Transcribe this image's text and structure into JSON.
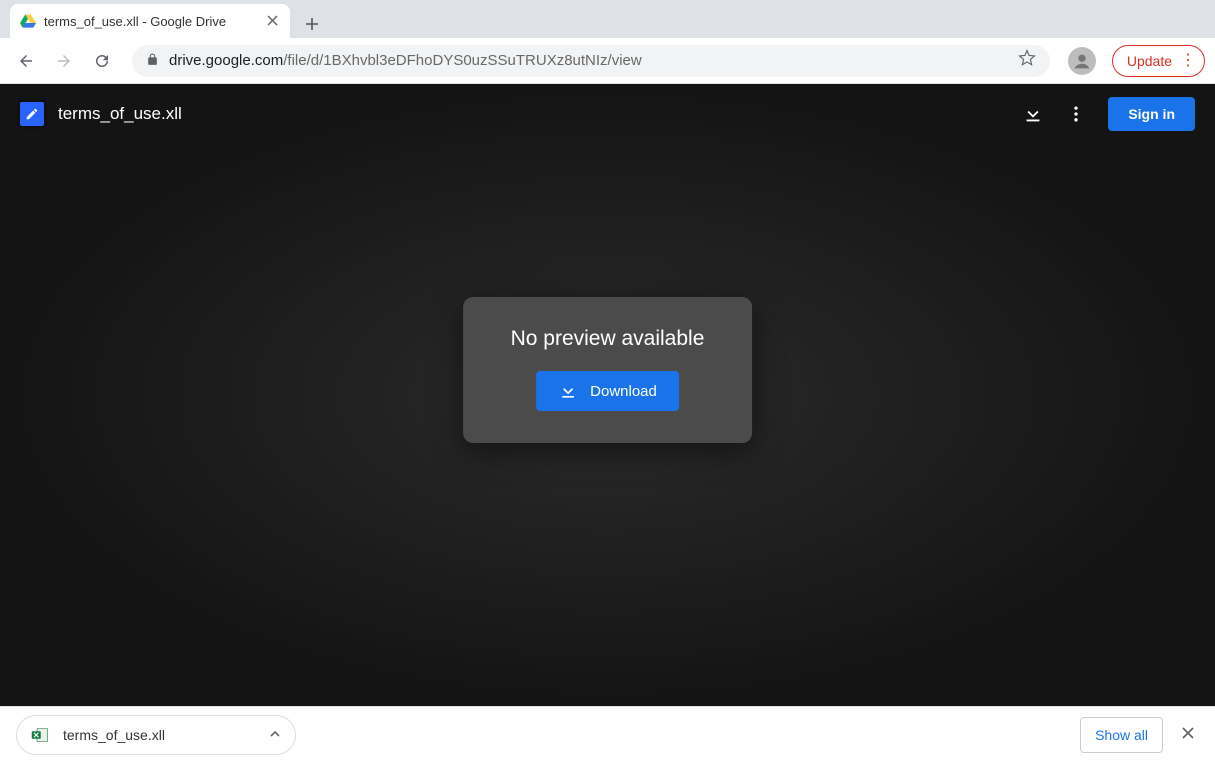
{
  "window": {
    "tab_title": "terms_of_use.xll - Google Drive"
  },
  "toolbar": {
    "url_host": "drive.google.com",
    "url_path": "/file/d/1BXhvbl3eDFhoDYS0uzSSuTRUXz8utNIz/view",
    "update_label": "Update"
  },
  "viewer": {
    "filename": "terms_of_use.xll",
    "no_preview_text": "No preview available",
    "download_label": "Download",
    "sign_in_label": "Sign in"
  },
  "download_bar": {
    "item_filename": "terms_of_use.xll",
    "show_all_label": "Show all"
  }
}
